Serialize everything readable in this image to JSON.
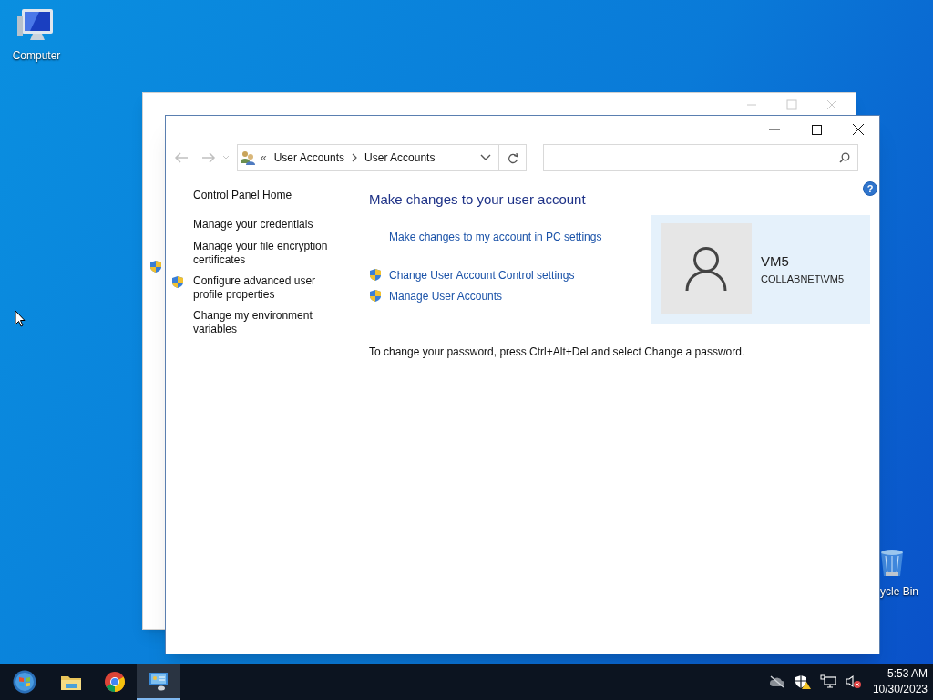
{
  "desktop_icons": [
    {
      "kind": "computer",
      "label": "Computer"
    },
    {
      "kind": "recycle",
      "label": "ycle Bin"
    }
  ],
  "window": {
    "overflow": "«",
    "breadcrumb": [
      "User Accounts",
      "User Accounts"
    ],
    "help": "?",
    "sidebar": [
      {
        "label": "Control Panel Home",
        "shield": false
      },
      {
        "label": "Manage your credentials",
        "shield": false
      },
      {
        "label": "Manage your file encryption certificates",
        "shield": false
      },
      {
        "label": "Configure advanced user profile properties",
        "shield": true
      },
      {
        "label": "Change my environment variables",
        "shield": false
      }
    ],
    "heading": "Make changes to your user account",
    "links": [
      {
        "label": "Make changes to my account in PC settings",
        "shield": false
      },
      {
        "label": "Change User Account Control settings",
        "shield": true
      },
      {
        "label": "Manage User Accounts",
        "shield": true
      }
    ],
    "user": {
      "name": "VM5",
      "account": "COLLABNET\\VM5"
    },
    "note": "To change your password, press Ctrl+Alt+Del and select Change a password."
  },
  "taskbar": {
    "items": [
      {
        "kind": "start",
        "selected": false
      },
      {
        "kind": "explorer",
        "selected": false
      },
      {
        "kind": "chrome",
        "selected": false
      },
      {
        "kind": "control",
        "selected": true
      }
    ],
    "time": "5:53 AM",
    "date": "10/30/2023"
  }
}
